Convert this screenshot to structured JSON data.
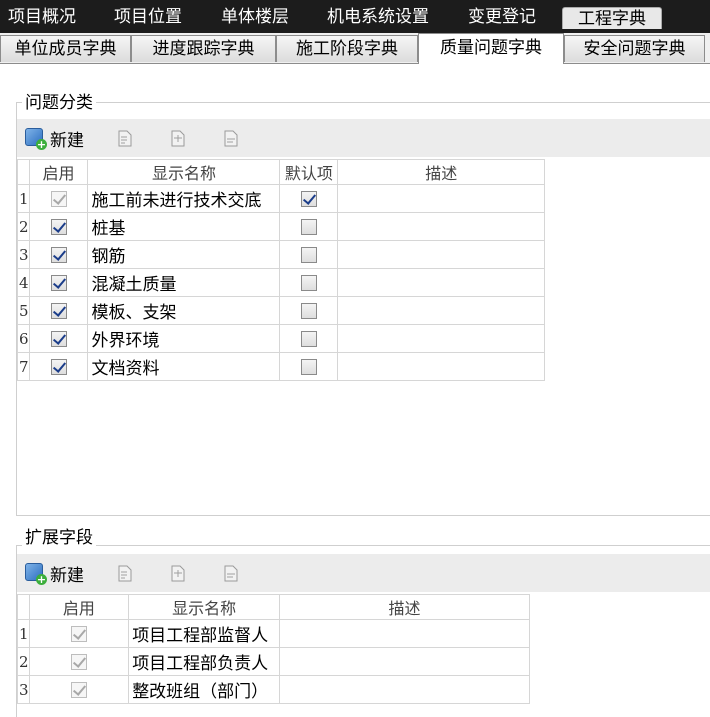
{
  "top_tabs": [
    {
      "label": "项目概况"
    },
    {
      "label": "项目位置"
    },
    {
      "label": "单体楼层"
    },
    {
      "label": "机电系统设置"
    },
    {
      "label": "变更登记"
    },
    {
      "label": "工程字典"
    }
  ],
  "sub_tabs": [
    {
      "label": "单位成员字典"
    },
    {
      "label": "进度跟踪字典"
    },
    {
      "label": "施工阶段字典"
    },
    {
      "label": "质量问题字典"
    },
    {
      "label": "安全问题字典"
    }
  ],
  "issue_group": {
    "title": "问题分类",
    "new_label": "新建",
    "columns": {
      "enabled": "启用",
      "name": "显示名称",
      "default": "默认项",
      "desc": "描述"
    },
    "rows": [
      {
        "num": "1",
        "enabled": true,
        "enabled_disabled": true,
        "name": "施工前未进行技术交底",
        "default": true,
        "desc": ""
      },
      {
        "num": "2",
        "enabled": true,
        "enabled_disabled": false,
        "name": "桩基",
        "default": false,
        "desc": ""
      },
      {
        "num": "3",
        "enabled": true,
        "enabled_disabled": false,
        "name": "钢筋",
        "default": false,
        "desc": ""
      },
      {
        "num": "4",
        "enabled": true,
        "enabled_disabled": false,
        "name": "混凝土质量",
        "default": false,
        "desc": ""
      },
      {
        "num": "5",
        "enabled": true,
        "enabled_disabled": false,
        "name": "模板、支架",
        "default": false,
        "desc": ""
      },
      {
        "num": "6",
        "enabled": true,
        "enabled_disabled": false,
        "name": "外界环境",
        "default": false,
        "desc": ""
      },
      {
        "num": "7",
        "enabled": true,
        "enabled_disabled": false,
        "name": "文档资料",
        "default": false,
        "desc": ""
      }
    ]
  },
  "ext_group": {
    "title": "扩展字段",
    "new_label": "新建",
    "columns": {
      "enabled": "启用",
      "name": "显示名称",
      "desc": "描述"
    },
    "rows": [
      {
        "num": "1",
        "enabled": true,
        "name": "项目工程部监督人",
        "desc": ""
      },
      {
        "num": "2",
        "enabled": true,
        "name": "项目工程部负责人",
        "desc": ""
      },
      {
        "num": "3",
        "enabled": true,
        "name": "整改班组（部门）",
        "desc": ""
      }
    ]
  },
  "colors": {
    "topbar": "#1c1c1c",
    "toolbar": "#ececec",
    "check": "#1b3d8a"
  }
}
